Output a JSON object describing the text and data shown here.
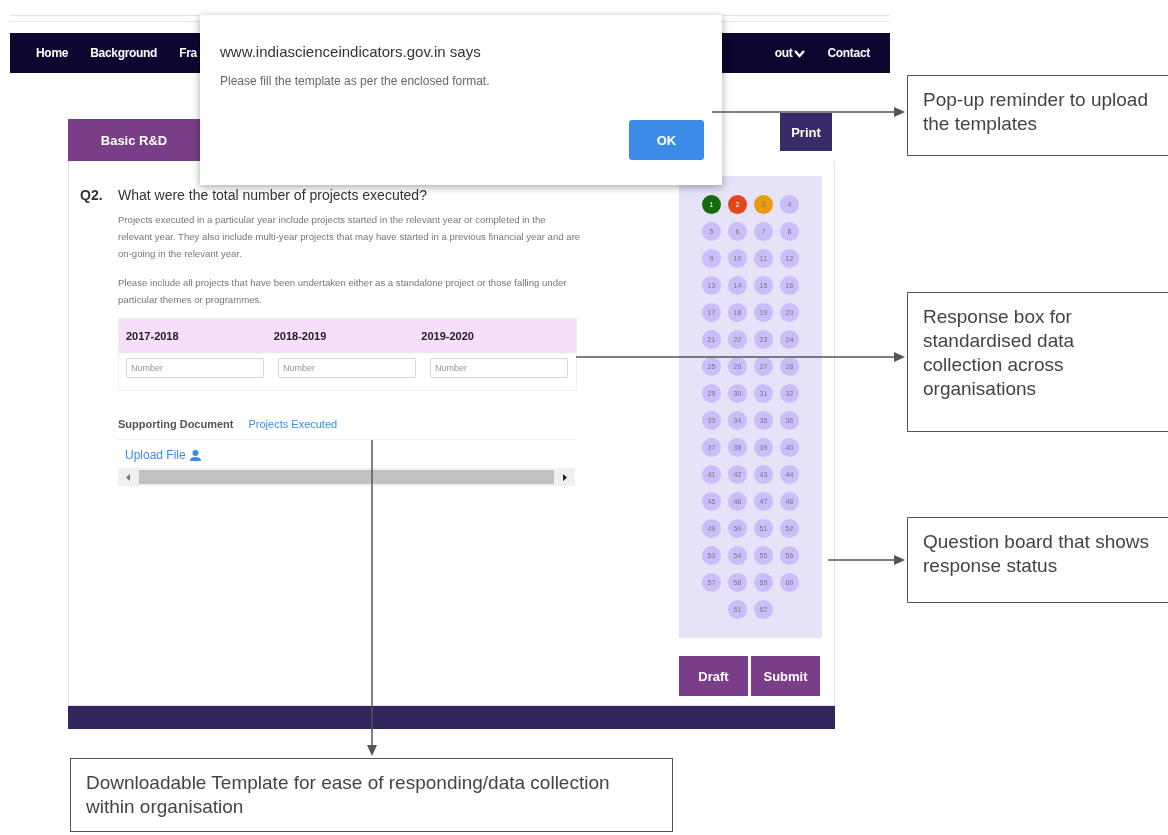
{
  "nav": {
    "left_items": [
      {
        "label": "Home",
        "kind": "link"
      },
      {
        "label": "Background",
        "kind": "link"
      },
      {
        "label": "Fra",
        "kind": "link"
      }
    ],
    "right_items": [
      {
        "label": "out",
        "kind": "dropdown"
      },
      {
        "label": "Contact",
        "kind": "link"
      }
    ]
  },
  "tabs": [
    {
      "label": "Basic R&D",
      "selected": true
    }
  ],
  "print_button": "Print",
  "question": {
    "number": "Q2.",
    "text": "What were the total number of projects executed?",
    "notes": [
      "Projects executed in a particular year include projects started in the relevant year or completed in the relevant year. They also include multi-year projects that may have started in a previous financial year and are on-going in the relevant year.",
      "Please include all projects that have been undertaken either as a standalone project or those falling under particular themes or programmes."
    ]
  },
  "response_table": {
    "columns": [
      {
        "label": "2017-2018",
        "placeholder": "Number"
      },
      {
        "label": "2018-2019",
        "placeholder": "Number"
      },
      {
        "label": "2019-2020",
        "placeholder": "Number"
      }
    ]
  },
  "supporting_document": {
    "label": "Supporting Document",
    "link": "Projects Executed",
    "upload": "Upload File"
  },
  "question_board": [
    {
      "label": "1",
      "color": "#17690f"
    },
    {
      "label": "2",
      "color": "#e2471c"
    },
    {
      "label": "3",
      "color": "#e99a12"
    },
    {
      "label": "4",
      "color": "#cbbcfa"
    },
    {
      "label": "5",
      "color": "#cbbcfa"
    },
    {
      "label": "6",
      "color": "#cbbcfa"
    },
    {
      "label": "7",
      "color": "#cbbcfa"
    },
    {
      "label": "8",
      "color": "#cbbcfa"
    },
    {
      "label": "9",
      "color": "#cbbcfa"
    },
    {
      "label": "10",
      "color": "#cbbcfa"
    },
    {
      "label": "11",
      "color": "#cbbcfa"
    },
    {
      "label": "12",
      "color": "#cbbcfa"
    },
    {
      "label": "13",
      "color": "#cbbcfa"
    },
    {
      "label": "14",
      "color": "#cbbcfa"
    },
    {
      "label": "15",
      "color": "#cbbcfa"
    },
    {
      "label": "16",
      "color": "#cbbcfa"
    },
    {
      "label": "17",
      "color": "#cbbcfa"
    },
    {
      "label": "18",
      "color": "#cbbcfa"
    },
    {
      "label": "19",
      "color": "#cbbcfa"
    },
    {
      "label": "20",
      "color": "#cbbcfa"
    },
    {
      "label": "21",
      "color": "#cbbcfa"
    },
    {
      "label": "22",
      "color": "#cbbcfa"
    },
    {
      "label": "23",
      "color": "#cbbcfa"
    },
    {
      "label": "24",
      "color": "#cbbcfa"
    },
    {
      "label": "25",
      "color": "#cbbcfa"
    },
    {
      "label": "26",
      "color": "#cbbcfa"
    },
    {
      "label": "27",
      "color": "#cbbcfa"
    },
    {
      "label": "28",
      "color": "#cbbcfa"
    },
    {
      "label": "29",
      "color": "#cbbcfa"
    },
    {
      "label": "30",
      "color": "#cbbcfa"
    },
    {
      "label": "31",
      "color": "#cbbcfa"
    },
    {
      "label": "32",
      "color": "#cbbcfa"
    },
    {
      "label": "33",
      "color": "#cbbcfa"
    },
    {
      "label": "34",
      "color": "#cbbcfa"
    },
    {
      "label": "35",
      "color": "#cbbcfa"
    },
    {
      "label": "36",
      "color": "#cbbcfa"
    },
    {
      "label": "37",
      "color": "#cbbcfa"
    },
    {
      "label": "38",
      "color": "#cbbcfa"
    },
    {
      "label": "39",
      "color": "#cbbcfa"
    },
    {
      "label": "40",
      "color": "#cbbcfa"
    },
    {
      "label": "41",
      "color": "#cbbcfa"
    },
    {
      "label": "42",
      "color": "#cbbcfa"
    },
    {
      "label": "43",
      "color": "#cbbcfa"
    },
    {
      "label": "44",
      "color": "#cbbcfa"
    },
    {
      "label": "45",
      "color": "#cbbcfa"
    },
    {
      "label": "46",
      "color": "#cbbcfa"
    },
    {
      "label": "47",
      "color": "#cbbcfa"
    },
    {
      "label": "48",
      "color": "#cbbcfa"
    },
    {
      "label": "49",
      "color": "#cbbcfa"
    },
    {
      "label": "50",
      "color": "#cbbcfa"
    },
    {
      "label": "51",
      "color": "#cbbcfa"
    },
    {
      "label": "52",
      "color": "#cbbcfa"
    },
    {
      "label": "53",
      "color": "#cbbcfa"
    },
    {
      "label": "54",
      "color": "#cbbcfa"
    },
    {
      "label": "55",
      "color": "#cbbcfa"
    },
    {
      "label": "56",
      "color": "#cbbcfa"
    },
    {
      "label": "57",
      "color": "#cbbcfa"
    },
    {
      "label": "58",
      "color": "#cbbcfa"
    },
    {
      "label": "59",
      "color": "#cbbcfa"
    },
    {
      "label": "60",
      "color": "#cbbcfa"
    },
    {
      "label": "61",
      "color": "#cbbcfa"
    },
    {
      "label": "62",
      "color": "#cbbcfa"
    }
  ],
  "buttons": [
    "Draft",
    "Submit"
  ],
  "dialog": {
    "title": "www.indiascienceindicators.gov.in says",
    "message": "Please fill the template as per the enclosed format.",
    "button": "OK"
  },
  "callouts": [
    {
      "text": "Pop-up reminder to upload the templates"
    },
    {
      "text": "Response box for standardised data collection across organisations"
    },
    {
      "text": "Question board  that shows response status"
    },
    {
      "text": "Downloadable Template for ease of responding/data collection within organisation"
    }
  ]
}
